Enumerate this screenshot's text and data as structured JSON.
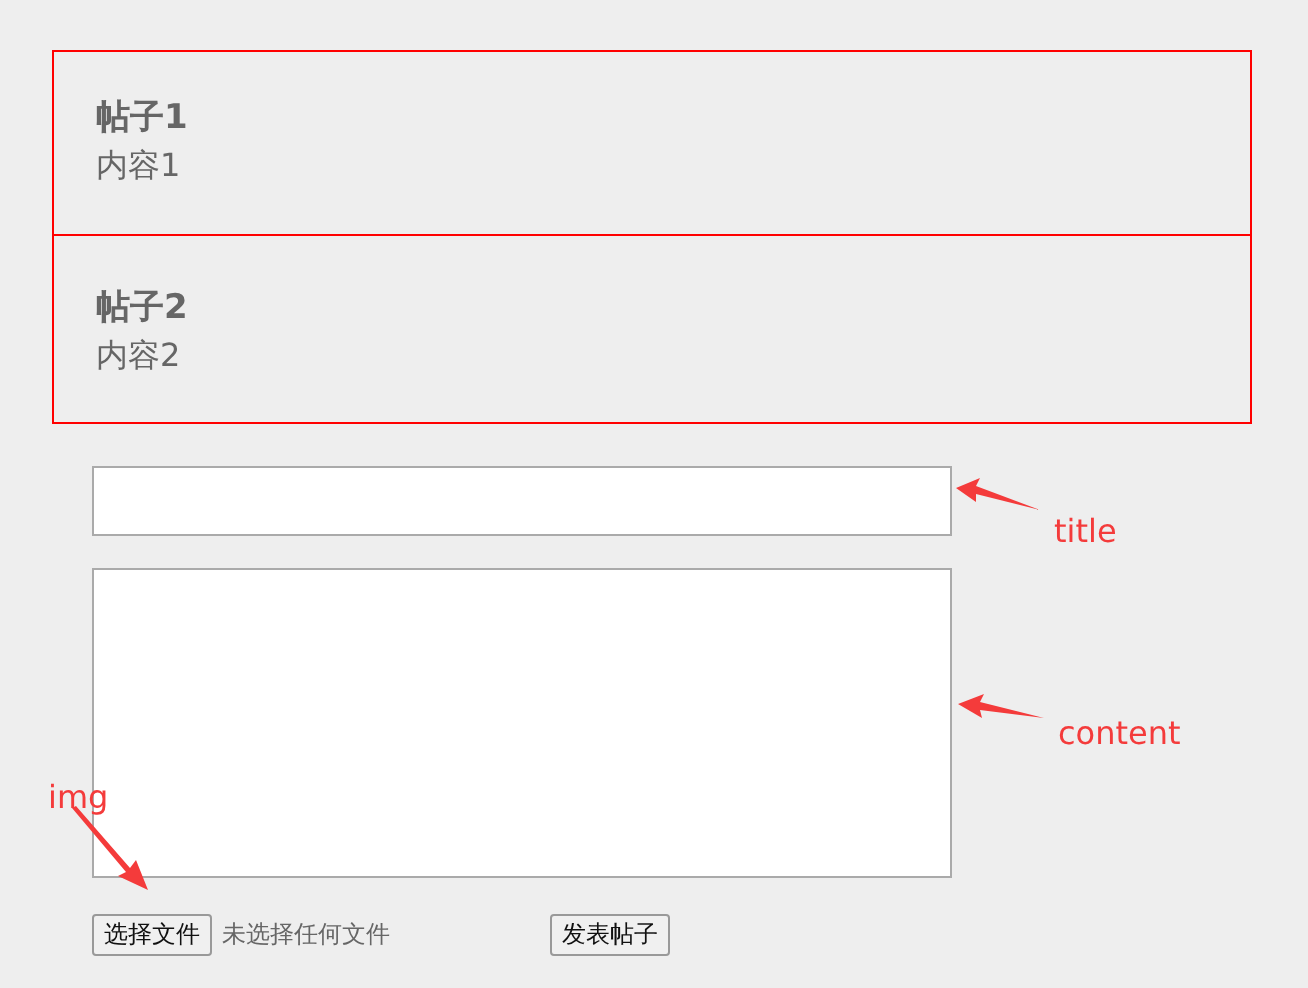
{
  "posts": [
    {
      "title": "帖子1",
      "content": "内容1"
    },
    {
      "title": "帖子2",
      "content": "内容2"
    }
  ],
  "form": {
    "file_button": "选择文件",
    "file_status": "未选择任何文件",
    "submit": "发表帖子"
  },
  "annotations": [
    {
      "label": "title"
    },
    {
      "label": "content"
    },
    {
      "label": "img"
    }
  ]
}
